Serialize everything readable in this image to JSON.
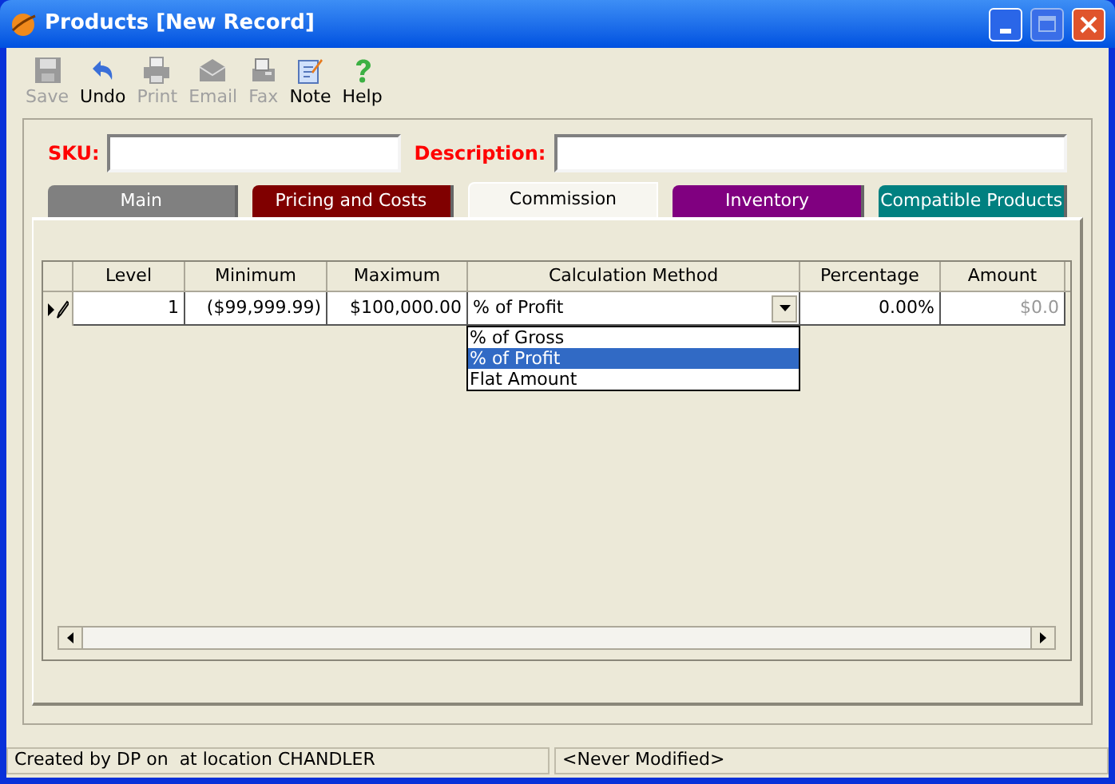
{
  "window": {
    "title": "Products [New Record]"
  },
  "toolbar": [
    {
      "label": "Save",
      "kind": "save",
      "disabled": true
    },
    {
      "label": "Undo",
      "kind": "undo",
      "disabled": false
    },
    {
      "label": "Print",
      "kind": "print",
      "disabled": true
    },
    {
      "label": "Email",
      "kind": "email",
      "disabled": true
    },
    {
      "label": "Fax",
      "kind": "fax",
      "disabled": true
    },
    {
      "label": "Note",
      "kind": "note",
      "disabled": false
    },
    {
      "label": "Help",
      "kind": "help",
      "disabled": false
    }
  ],
  "fields": [
    {
      "label": "SKU:"
    },
    {
      "label": "Description:"
    }
  ],
  "tabs": [
    {
      "label": "Main",
      "color": "#808080",
      "selected": false
    },
    {
      "label": "Pricing and Costs",
      "color": "#800000",
      "selected": false
    },
    {
      "label": "Commission",
      "selected": true
    },
    {
      "label": "Inventory",
      "color": "#800080",
      "selected": false
    },
    {
      "label": "Compatible Products",
      "color": "#008080",
      "selected": false
    }
  ],
  "grid": {
    "columns": [
      "Level",
      "Minimum",
      "Maximum",
      "Calculation Method",
      "Percentage",
      "Amount"
    ],
    "rows": [
      {
        "cells": [
          "1",
          "($99,999.99)",
          "$100,000.00",
          "% of Profit",
          "0.00%",
          "$0.0"
        ]
      }
    ],
    "dropdown": [
      {
        "label": "% of Gross",
        "selected": false
      },
      {
        "label": "% of Profit",
        "selected": true
      },
      {
        "label": "Flat Amount",
        "selected": false
      }
    ]
  },
  "status_bar": [
    "Created by DP on  at location CHANDLER",
    "<Never Modified>"
  ]
}
